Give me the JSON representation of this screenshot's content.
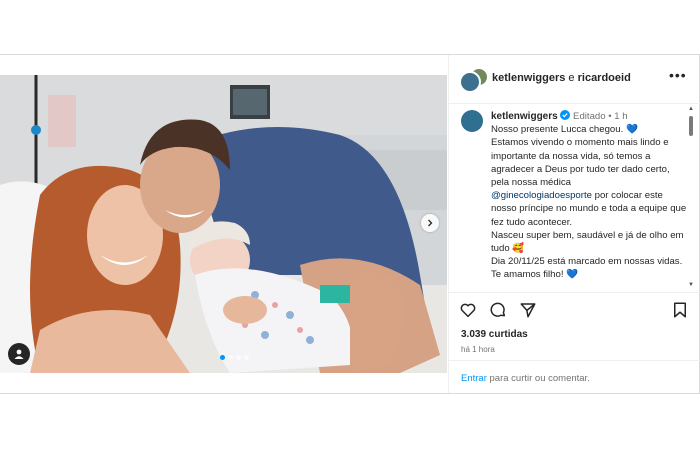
{
  "post": {
    "owner1": "ketlenwiggers",
    "connector": "e",
    "owner2": "ricardoeid",
    "more_label": "•••"
  },
  "caption": {
    "username": "ketlenwiggers",
    "edited": "Editado",
    "sep": "•",
    "time_ago": "1 h",
    "line1": "Nosso presente Lucca chegou.",
    "line2": "Estamos vivendo o momento mais lindo e importante da nossa vida, só temos a agradecer a Deus por tudo ter dado certo, pela nossa médica",
    "mention": "@ginecologiadoesporte",
    "line3": " por colocar este nosso príncipe no mundo e toda a equipe que fez tudo acontecer.",
    "line4": "Nasceu super bem, saudável e já de olho em tudo",
    "line5": "Dia 20/11/25 está marcado em nossas vidas. Te amamos filho!",
    "heart_emoji": "💙",
    "love_emoji": "🥰"
  },
  "actions": {
    "likes": "3.039 curtidas",
    "posted": "há 1 hora"
  },
  "comment": {
    "login_link": "Entrar",
    "rest": " para curtir ou comentar."
  },
  "carousel": {
    "current_index": 1,
    "count": 4
  },
  "colors": {
    "link_blue": "#0095f6",
    "mention_blue": "#00376b",
    "verified_blue": "#0095f6"
  }
}
